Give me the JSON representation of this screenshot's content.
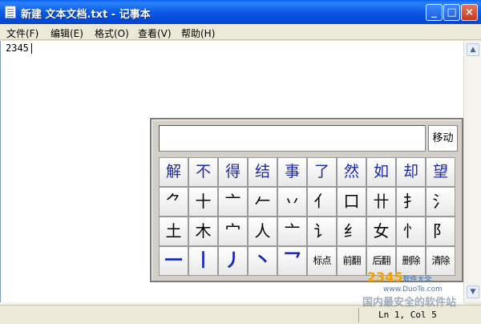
{
  "window": {
    "title": "新建 文本文档.txt - 记事本",
    "min_label": "_",
    "max_label": "□",
    "close_label": "×"
  },
  "menu": [
    {
      "label": "文件(F)"
    },
    {
      "label": "编辑(E)"
    },
    {
      "label": "格式(O)"
    },
    {
      "label": "查看(V)"
    },
    {
      "label": "帮助(H)"
    }
  ],
  "editor": {
    "content": "2345"
  },
  "status": {
    "position": "Ln 1, Col 5"
  },
  "ime": {
    "move_label": "移动",
    "candidates": [
      "解",
      "不",
      "得",
      "结",
      "事",
      "了",
      "然",
      "如",
      "却",
      "望"
    ],
    "radicals_row1": [
      "⺈",
      "十",
      "亠",
      "𠂉",
      "丷",
      "亻",
      "口",
      "卄",
      "扌",
      "氵"
    ],
    "radicals_row2": [
      "土",
      "木",
      "宀",
      "人",
      "亠",
      "讠",
      "纟",
      "女",
      "忄",
      "阝"
    ],
    "strokes": [
      "一",
      "丨",
      "丿",
      "丶",
      "乛"
    ],
    "functions": [
      "标点",
      "前翻",
      "后翻",
      "删除",
      "清除"
    ]
  },
  "watermark": {
    "center": "www.DuoTe.com",
    "logo_a": "2345",
    "logo_b": "软件大全",
    "site": "www.DuoTe.com",
    "bottom": "国内最安全的软件站"
  }
}
